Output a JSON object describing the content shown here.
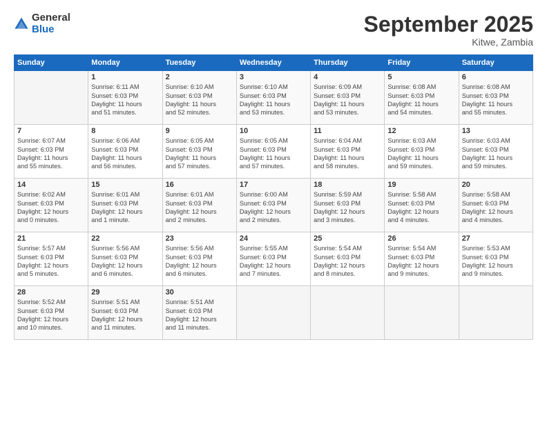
{
  "header": {
    "logo_general": "General",
    "logo_blue": "Blue",
    "month_title": "September 2025",
    "subtitle": "Kitwe, Zambia"
  },
  "days_of_week": [
    "Sunday",
    "Monday",
    "Tuesday",
    "Wednesday",
    "Thursday",
    "Friday",
    "Saturday"
  ],
  "weeks": [
    [
      {
        "day": "",
        "info": ""
      },
      {
        "day": "1",
        "info": "Sunrise: 6:11 AM\nSunset: 6:03 PM\nDaylight: 11 hours\nand 51 minutes."
      },
      {
        "day": "2",
        "info": "Sunrise: 6:10 AM\nSunset: 6:03 PM\nDaylight: 11 hours\nand 52 minutes."
      },
      {
        "day": "3",
        "info": "Sunrise: 6:10 AM\nSunset: 6:03 PM\nDaylight: 11 hours\nand 53 minutes."
      },
      {
        "day": "4",
        "info": "Sunrise: 6:09 AM\nSunset: 6:03 PM\nDaylight: 11 hours\nand 53 minutes."
      },
      {
        "day": "5",
        "info": "Sunrise: 6:08 AM\nSunset: 6:03 PM\nDaylight: 11 hours\nand 54 minutes."
      },
      {
        "day": "6",
        "info": "Sunrise: 6:08 AM\nSunset: 6:03 PM\nDaylight: 11 hours\nand 55 minutes."
      }
    ],
    [
      {
        "day": "7",
        "info": "Sunrise: 6:07 AM\nSunset: 6:03 PM\nDaylight: 11 hours\nand 55 minutes."
      },
      {
        "day": "8",
        "info": "Sunrise: 6:06 AM\nSunset: 6:03 PM\nDaylight: 11 hours\nand 56 minutes."
      },
      {
        "day": "9",
        "info": "Sunrise: 6:05 AM\nSunset: 6:03 PM\nDaylight: 11 hours\nand 57 minutes."
      },
      {
        "day": "10",
        "info": "Sunrise: 6:05 AM\nSunset: 6:03 PM\nDaylight: 11 hours\nand 57 minutes."
      },
      {
        "day": "11",
        "info": "Sunrise: 6:04 AM\nSunset: 6:03 PM\nDaylight: 11 hours\nand 58 minutes."
      },
      {
        "day": "12",
        "info": "Sunrise: 6:03 AM\nSunset: 6:03 PM\nDaylight: 11 hours\nand 59 minutes."
      },
      {
        "day": "13",
        "info": "Sunrise: 6:03 AM\nSunset: 6:03 PM\nDaylight: 11 hours\nand 59 minutes."
      }
    ],
    [
      {
        "day": "14",
        "info": "Sunrise: 6:02 AM\nSunset: 6:03 PM\nDaylight: 12 hours\nand 0 minutes."
      },
      {
        "day": "15",
        "info": "Sunrise: 6:01 AM\nSunset: 6:03 PM\nDaylight: 12 hours\nand 1 minute."
      },
      {
        "day": "16",
        "info": "Sunrise: 6:01 AM\nSunset: 6:03 PM\nDaylight: 12 hours\nand 2 minutes."
      },
      {
        "day": "17",
        "info": "Sunrise: 6:00 AM\nSunset: 6:03 PM\nDaylight: 12 hours\nand 2 minutes."
      },
      {
        "day": "18",
        "info": "Sunrise: 5:59 AM\nSunset: 6:03 PM\nDaylight: 12 hours\nand 3 minutes."
      },
      {
        "day": "19",
        "info": "Sunrise: 5:58 AM\nSunset: 6:03 PM\nDaylight: 12 hours\nand 4 minutes."
      },
      {
        "day": "20",
        "info": "Sunrise: 5:58 AM\nSunset: 6:03 PM\nDaylight: 12 hours\nand 4 minutes."
      }
    ],
    [
      {
        "day": "21",
        "info": "Sunrise: 5:57 AM\nSunset: 6:03 PM\nDaylight: 12 hours\nand 5 minutes."
      },
      {
        "day": "22",
        "info": "Sunrise: 5:56 AM\nSunset: 6:03 PM\nDaylight: 12 hours\nand 6 minutes."
      },
      {
        "day": "23",
        "info": "Sunrise: 5:56 AM\nSunset: 6:03 PM\nDaylight: 12 hours\nand 6 minutes."
      },
      {
        "day": "24",
        "info": "Sunrise: 5:55 AM\nSunset: 6:03 PM\nDaylight: 12 hours\nand 7 minutes."
      },
      {
        "day": "25",
        "info": "Sunrise: 5:54 AM\nSunset: 6:03 PM\nDaylight: 12 hours\nand 8 minutes."
      },
      {
        "day": "26",
        "info": "Sunrise: 5:54 AM\nSunset: 6:03 PM\nDaylight: 12 hours\nand 9 minutes."
      },
      {
        "day": "27",
        "info": "Sunrise: 5:53 AM\nSunset: 6:03 PM\nDaylight: 12 hours\nand 9 minutes."
      }
    ],
    [
      {
        "day": "28",
        "info": "Sunrise: 5:52 AM\nSunset: 6:03 PM\nDaylight: 12 hours\nand 10 minutes."
      },
      {
        "day": "29",
        "info": "Sunrise: 5:51 AM\nSunset: 6:03 PM\nDaylight: 12 hours\nand 11 minutes."
      },
      {
        "day": "30",
        "info": "Sunrise: 5:51 AM\nSunset: 6:03 PM\nDaylight: 12 hours\nand 11 minutes."
      },
      {
        "day": "",
        "info": ""
      },
      {
        "day": "",
        "info": ""
      },
      {
        "day": "",
        "info": ""
      },
      {
        "day": "",
        "info": ""
      }
    ]
  ]
}
